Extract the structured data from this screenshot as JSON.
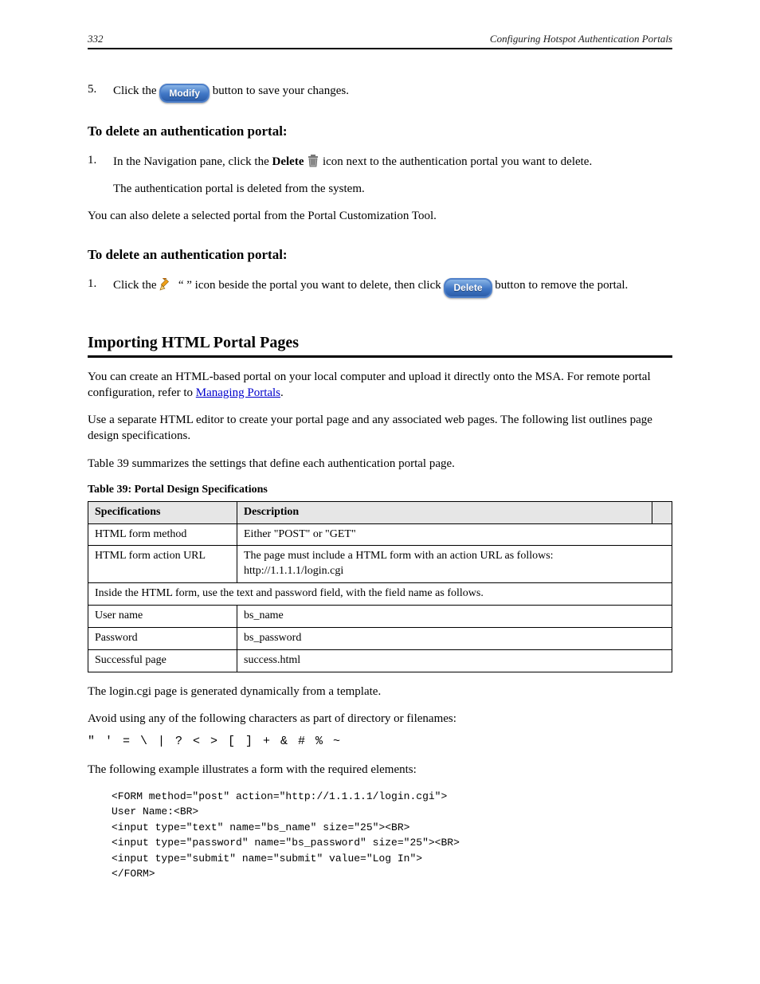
{
  "header": {
    "left": "332",
    "right": "Configuring Hotspot Authentication Portals"
  },
  "step5": {
    "num": "5.",
    "text_before": "Click the ",
    "button_label": "Modify",
    "text_after": " button to save your changes."
  },
  "proc_delete_portal": {
    "title": "To delete an authentication portal:",
    "step1": {
      "num": "1.",
      "text_before": "In the Navigation pane, click the ",
      "icon_name": "Delete",
      "text_after": " icon next to the authentication portal you want to delete."
    },
    "indent_line": "The authentication portal is deleted from the system."
  },
  "single_line": "You can also delete a selected portal from the Portal Customization Tool.",
  "proc_delete_portal_alt": {
    "title": "To delete an authentication portal:",
    "step1": {
      "num": "1.",
      "before_icon": "Click the ",
      "after_icon": " icon beside the portal you want to delete, then click ",
      "last": " button to remove the portal.",
      "delete_button": "Delete"
    }
  },
  "section": {
    "title": "Importing HTML Portal Pages",
    "para1_a": "You can create an HTML-based portal on your local computer and upload it directly onto the MSA. For remote portal configuration, refer to ",
    "link": "Managing Portals",
    "para1_b": ".",
    "para2": "Use a separate HTML editor to create your portal page and any associated web pages. The following list outlines page design specifications.",
    "table_caption_before": "Table 39",
    "table_caption_after": " summarizes the settings that define each authentication portal page.",
    "tbl_title": "Table 39: Portal Design Specifications",
    "tbl": {
      "header1": "Specifications",
      "header2": "Description",
      "rows": [
        [
          "HTML form method",
          "Either \"POST\" or \"GET\""
        ],
        [
          "HTML form action URL",
          "The page must include a HTML form with an action URL as follows:\nhttp://1.1.1.1/login.cgi"
        ],
        [
          "span",
          "Inside the HTML form, use the text and password field, with the field name as follows."
        ],
        [
          "User name",
          "bs_name"
        ],
        [
          "Password",
          "bs_password"
        ],
        [
          "Successful page",
          "success.html"
        ]
      ]
    },
    "cgi_note_1": "The login.cgi page is generated dynamically from a template.",
    "char_label": "Avoid using any of the following characters as part of directory or filenames:",
    "chars": "\" ' = \\ | ? < > [ ] + & # % ~",
    "example_lead": "The following example illustrates a form with the required elements:",
    "code": [
      "<FORM method=\"post\" action=\"http://1.1.1.1/login.cgi\">",
      "User Name:<BR>",
      "<input type=\"text\" name=\"bs_name\" size=\"25\"><BR>",
      "<input type=\"password\" name=\"bs_password\" size=\"25\"><BR>",
      "<input type=\"submit\" name=\"submit\" value=\"Log In\">",
      "</FORM>"
    ]
  }
}
